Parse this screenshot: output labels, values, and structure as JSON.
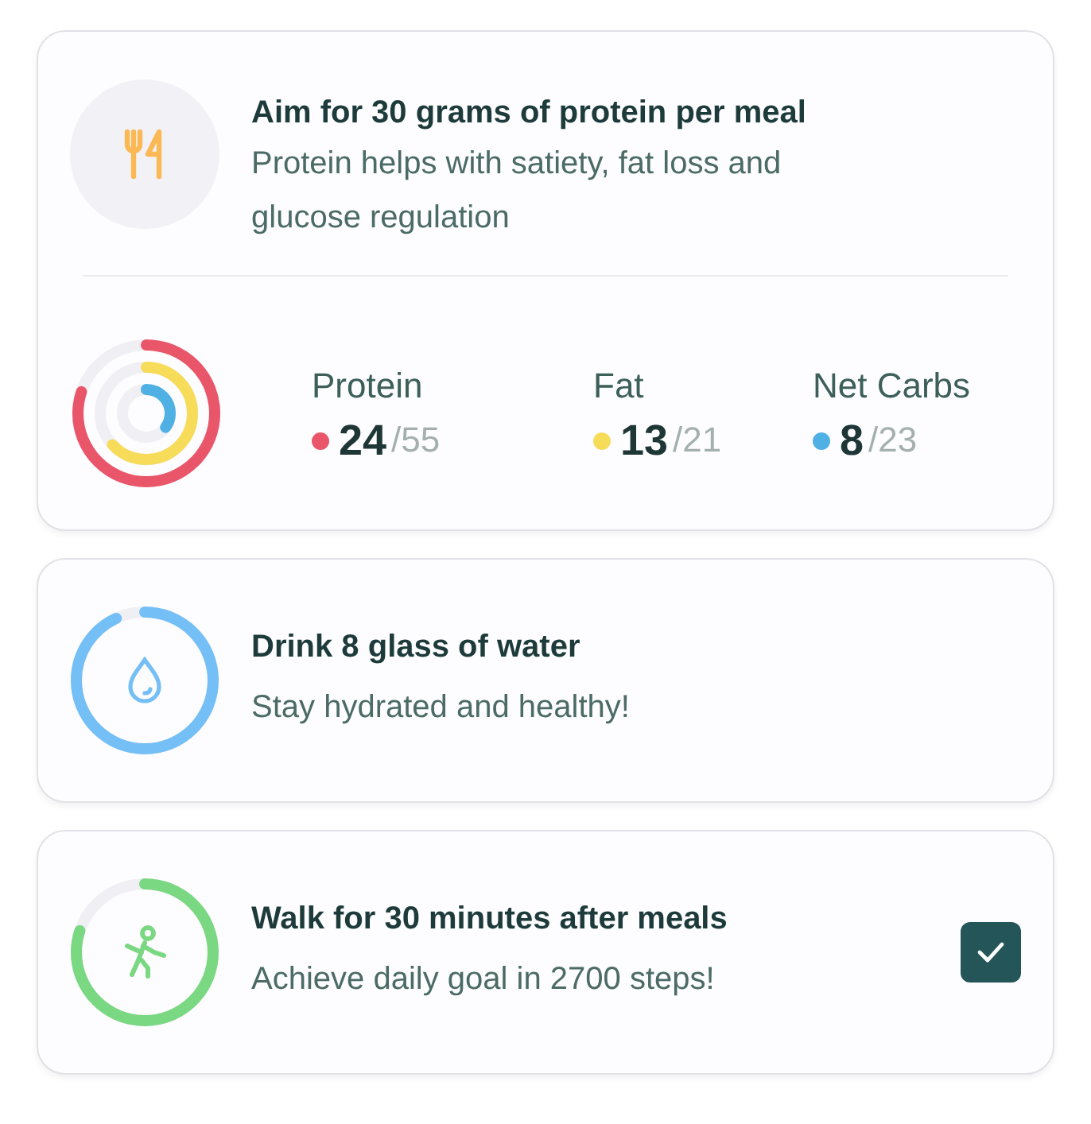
{
  "protein_card": {
    "title": "Aim for 30 grams of protein per meal",
    "description": "Protein helps with satiety, fat loss and glucose regulation",
    "macros": [
      {
        "name": "Protein",
        "value": "24",
        "target": "/55",
        "color": "#e9566a"
      },
      {
        "name": "Fat",
        "value": "13",
        "target": "/21",
        "color": "#f7dc5a"
      },
      {
        "name": "Net Carbs",
        "value": "8",
        "target": "/23",
        "color": "#4fb0e3"
      }
    ]
  },
  "goals": [
    {
      "kind": "water",
      "title": "Drink 8 glass of water",
      "description": "Stay hydrated and healthy!",
      "color": "#74bff5",
      "checked": false
    },
    {
      "kind": "walk",
      "title": "Walk for 30 minutes after meals",
      "description": "Achieve daily goal in 2700 steps!",
      "color": "#7bd882",
      "checked": true
    }
  ]
}
